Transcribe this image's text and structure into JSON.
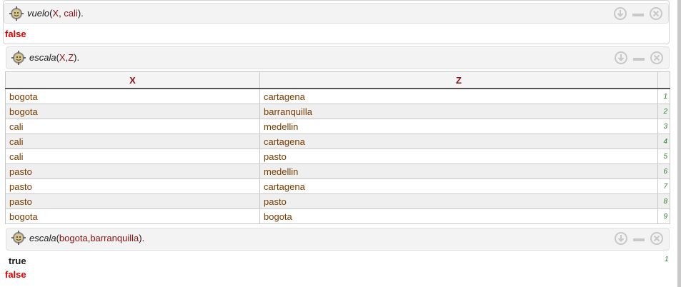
{
  "queries": [
    {
      "pred": "vuelo",
      "args": [
        {
          "text": "X",
          "type": "arg"
        },
        {
          "text": ", ",
          "type": "punct"
        },
        {
          "text": "cali",
          "type": "arg"
        }
      ],
      "close": ")."
    },
    {
      "pred": "escala",
      "args": [
        {
          "text": "X",
          "type": "arg"
        },
        {
          "text": ",",
          "type": "punct"
        },
        {
          "text": "Z",
          "type": "arg"
        }
      ],
      "close": ")."
    },
    {
      "pred": "escala",
      "args": [
        {
          "text": "bogota",
          "type": "arg"
        },
        {
          "text": ",",
          "type": "punct"
        },
        {
          "text": "barranquilla",
          "type": "arg"
        }
      ],
      "close": ")."
    }
  ],
  "results": {
    "q1": "false",
    "q3_true": "true",
    "q3_true_num": "1",
    "q3_false": "false"
  },
  "table": {
    "columns": [
      "X",
      "Z"
    ],
    "rows": [
      {
        "x": "bogota",
        "z": "cartagena",
        "n": "1"
      },
      {
        "x": "bogota",
        "z": "barranquilla",
        "n": "2"
      },
      {
        "x": "cali",
        "z": "medellin",
        "n": "3"
      },
      {
        "x": "cali",
        "z": "cartagena",
        "n": "4"
      },
      {
        "x": "cali",
        "z": "pasto",
        "n": "5"
      },
      {
        "x": "pasto",
        "z": "medellin",
        "n": "6"
      },
      {
        "x": "pasto",
        "z": "cartagena",
        "n": "7"
      },
      {
        "x": "pasto",
        "z": "pasto",
        "n": "8"
      },
      {
        "x": "bogota",
        "z": "bogota",
        "n": "9"
      }
    ]
  },
  "icons": {
    "gear": "gear-icon",
    "down": "download-arrow-icon",
    "minimize": "minimize-icon",
    "close": "close-circle-icon"
  },
  "colors": {
    "false": "#e00000",
    "arg": "#8a1010",
    "cell": "#7a3d00",
    "row_num": "#2a7a2a"
  }
}
